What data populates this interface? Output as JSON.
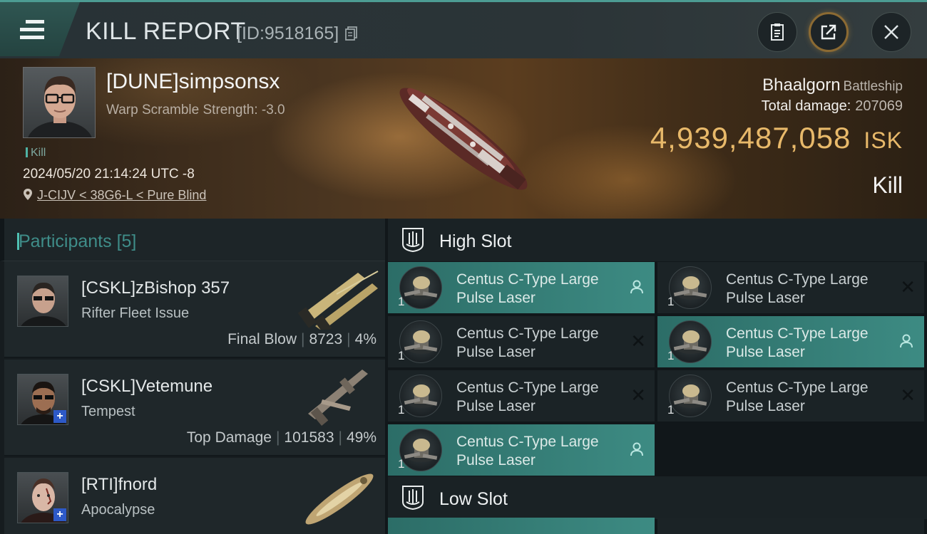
{
  "header": {
    "title": "KILL REPORT",
    "id_label": "[ID:9518165]"
  },
  "victim": {
    "pilot": "[DUNE]simpsonsx",
    "warp_scramble": "Warp Scramble Strength: -3.0",
    "tag": "Kill",
    "datetime": "2024/05/20 21:14:24 UTC -8",
    "location": "J-CIJV < 38G6-L < Pure Blind",
    "ship": "Bhaalgorn",
    "ship_class": "Battleship",
    "total_damage_label": "Total damage:",
    "total_damage": "207069",
    "isk_value": "4,939,487,058",
    "isk_unit": "ISK",
    "result": "Kill"
  },
  "participants": {
    "title": "Participants",
    "count": "[5]",
    "items": [
      {
        "name": "[CSKL]zBishop 357",
        "ship": "Rifter Fleet Issue",
        "role": "Final Blow",
        "damage": "8723",
        "percent": "4%",
        "plus": false
      },
      {
        "name": "[CSKL]Vetemune",
        "ship": "Tempest",
        "role": "Top Damage",
        "damage": "101583",
        "percent": "49%",
        "plus": true
      },
      {
        "name": "[RTI]fnord",
        "ship": "Apocalypse",
        "role": "",
        "damage": "",
        "percent": "",
        "plus": true
      }
    ]
  },
  "slots": {
    "high": {
      "title": "High Slot",
      "modules": [
        {
          "line1": "Centus C-Type Large",
          "line2": "Pulse Laser",
          "qty": "1",
          "status": "dropped"
        },
        {
          "line1": "Centus C-Type Large",
          "line2": "Pulse Laser",
          "qty": "1",
          "status": "destroyed"
        },
        {
          "line1": "Centus C-Type Large",
          "line2": "Pulse Laser",
          "qty": "1",
          "status": "destroyed"
        },
        {
          "line1": "Centus C-Type Large",
          "line2": "Pulse Laser",
          "qty": "1",
          "status": "dropped"
        },
        {
          "line1": "Centus C-Type Large",
          "line2": "Pulse Laser",
          "qty": "1",
          "status": "destroyed"
        },
        {
          "line1": "Centus C-Type Large",
          "line2": "Pulse Laser",
          "qty": "1",
          "status": "destroyed"
        },
        {
          "line1": "Centus C-Type Large",
          "line2": "Pulse Laser",
          "qty": "1",
          "status": "dropped"
        }
      ]
    },
    "low": {
      "title": "Low Slot"
    }
  },
  "colors": {
    "accent_teal": "#3d8b83",
    "isk_gold": "#e8b96a",
    "participants_title": "#3f8d89"
  }
}
